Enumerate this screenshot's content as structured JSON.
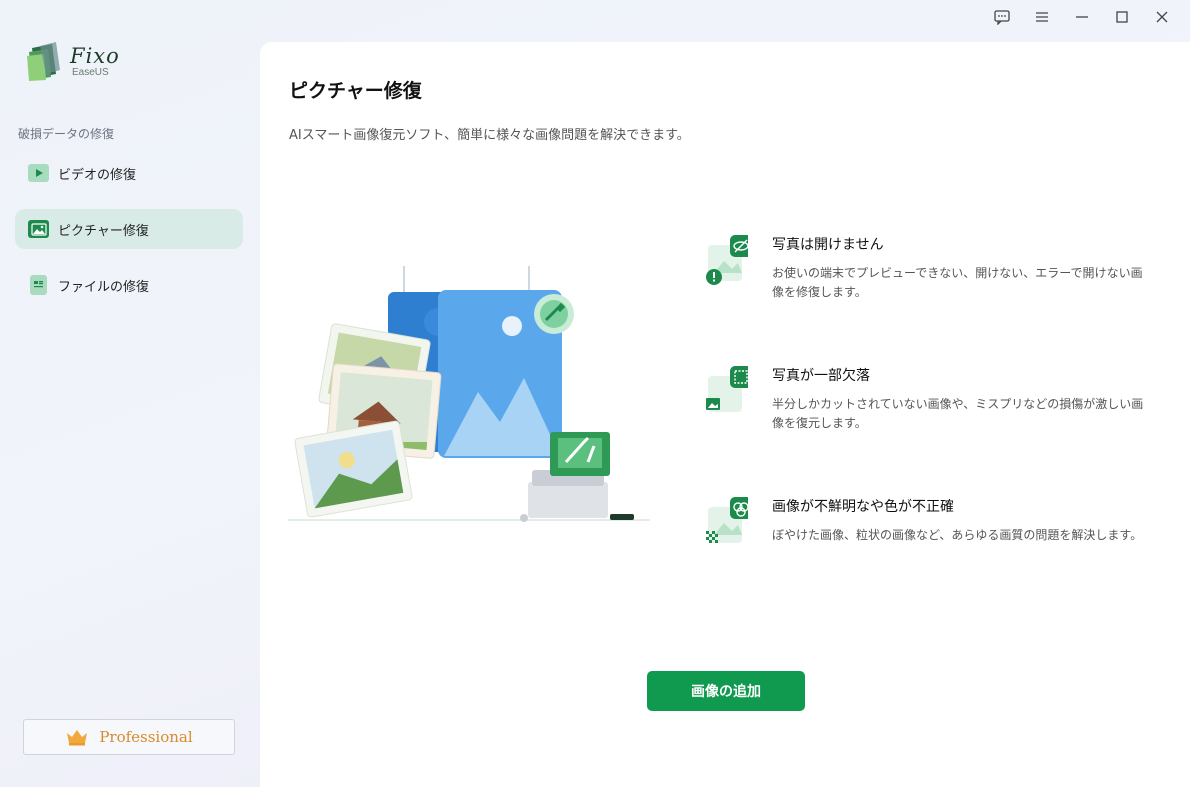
{
  "window": {
    "controls": [
      "feedback-icon",
      "menu-icon",
      "minimize-icon",
      "maximize-icon",
      "close-icon"
    ]
  },
  "app": {
    "name": "Fixo",
    "subname": "EaseUS"
  },
  "sidebar": {
    "section_label": "破損データの修復",
    "items": [
      {
        "label": "ビデオの修復",
        "icon": "video-icon",
        "active": false
      },
      {
        "label": "ピクチャー修復",
        "icon": "picture-icon",
        "active": true
      },
      {
        "label": "ファイルの修復",
        "icon": "file-icon",
        "active": false
      }
    ],
    "pro_label": "Professional"
  },
  "main": {
    "title": "ピクチャー修復",
    "subtitle": "AIスマート画像復元ソフト、簡単に様々な画像問題を解決できます。",
    "features": [
      {
        "title": "写真は開けません",
        "description": "お使いの端末でプレビューできない、開けない、エラーで開けない画像を修復します。",
        "icon": "hidden-eye-icon"
      },
      {
        "title": "写真が一部欠落",
        "description": "半分しかカットされていない画像や、ミスプリなどの損傷が激しい画像を復元します。",
        "icon": "crop-frame-icon"
      },
      {
        "title": "画像が不鮮明なや色が不正確",
        "description": "ぼやけた画像、粒状の画像など、あらゆる画質の問題を解決します。",
        "icon": "color-circles-icon"
      }
    ],
    "add_button": "画像の追加"
  },
  "colors": {
    "accent": "#0f9a4f",
    "active_nav": "#d8ebe6",
    "pro_text": "#d88b2c"
  }
}
